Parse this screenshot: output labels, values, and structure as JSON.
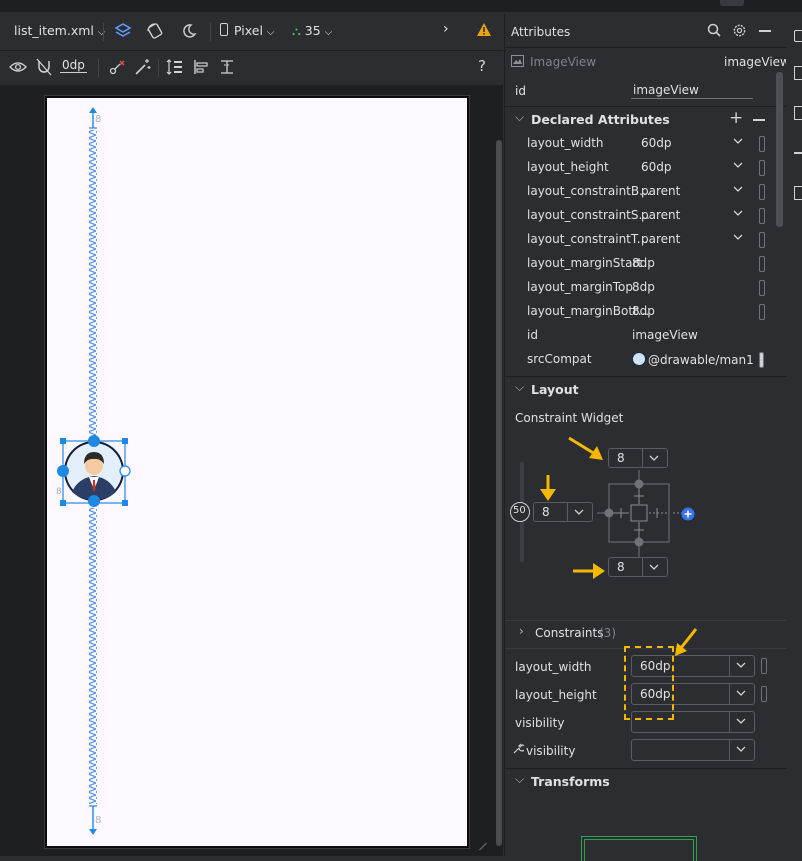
{
  "toolbar": {
    "file_name": "list_item.xml",
    "device": "Pixel",
    "api_level": "35",
    "default_margin": "0dp",
    "help": "?"
  },
  "blueprint": {
    "top_margin_label": "8",
    "bottom_margin_label": "8",
    "left_margin_label": "8"
  },
  "attributes": {
    "panel_title": "Attributes",
    "component_type": "ImageView",
    "component_name": "imageView",
    "id_label": "id",
    "id_value": "imageView",
    "declared_title": "Declared Attributes",
    "declared": [
      {
        "name": "layout_width",
        "value": "60dp",
        "dropdown": true
      },
      {
        "name": "layout_height",
        "value": "60dp",
        "dropdown": true
      },
      {
        "name": "layout_constraintB...",
        "value": "parent",
        "dropdown": true
      },
      {
        "name": "layout_constraintS...",
        "value": "parent",
        "dropdown": true
      },
      {
        "name": "layout_constraintT...",
        "value": "parent",
        "dropdown": true
      },
      {
        "name": "layout_marginStart",
        "value": "8dp",
        "dropdown": false
      },
      {
        "name": "layout_marginTop",
        "value": "8dp",
        "dropdown": false
      },
      {
        "name": "layout_marginBott...",
        "value": "8dp",
        "dropdown": false
      },
      {
        "name": "id",
        "value": "imageView",
        "dropdown": false
      },
      {
        "name": "srcCompat",
        "value": "@drawable/man1",
        "dropdown": false
      }
    ],
    "layout_title": "Layout",
    "constraint_widget_label": "Constraint Widget",
    "cw_top": "8",
    "cw_left": "8",
    "cw_bottom": "8",
    "bias": "50",
    "constraints_label": "Constraints",
    "constraints_count": "(3)",
    "layout_width_label": "layout_width",
    "layout_width_value": "60dp",
    "layout_height_label": "layout_height",
    "layout_height_value": "60dp",
    "visibility_label": "visibility",
    "tools_visibility_label": "visibility",
    "transforms_title": "Transforms"
  },
  "colors": {
    "accent": "#3574f0",
    "highlight": "#f5b800",
    "constraint": "#1e88e5"
  }
}
